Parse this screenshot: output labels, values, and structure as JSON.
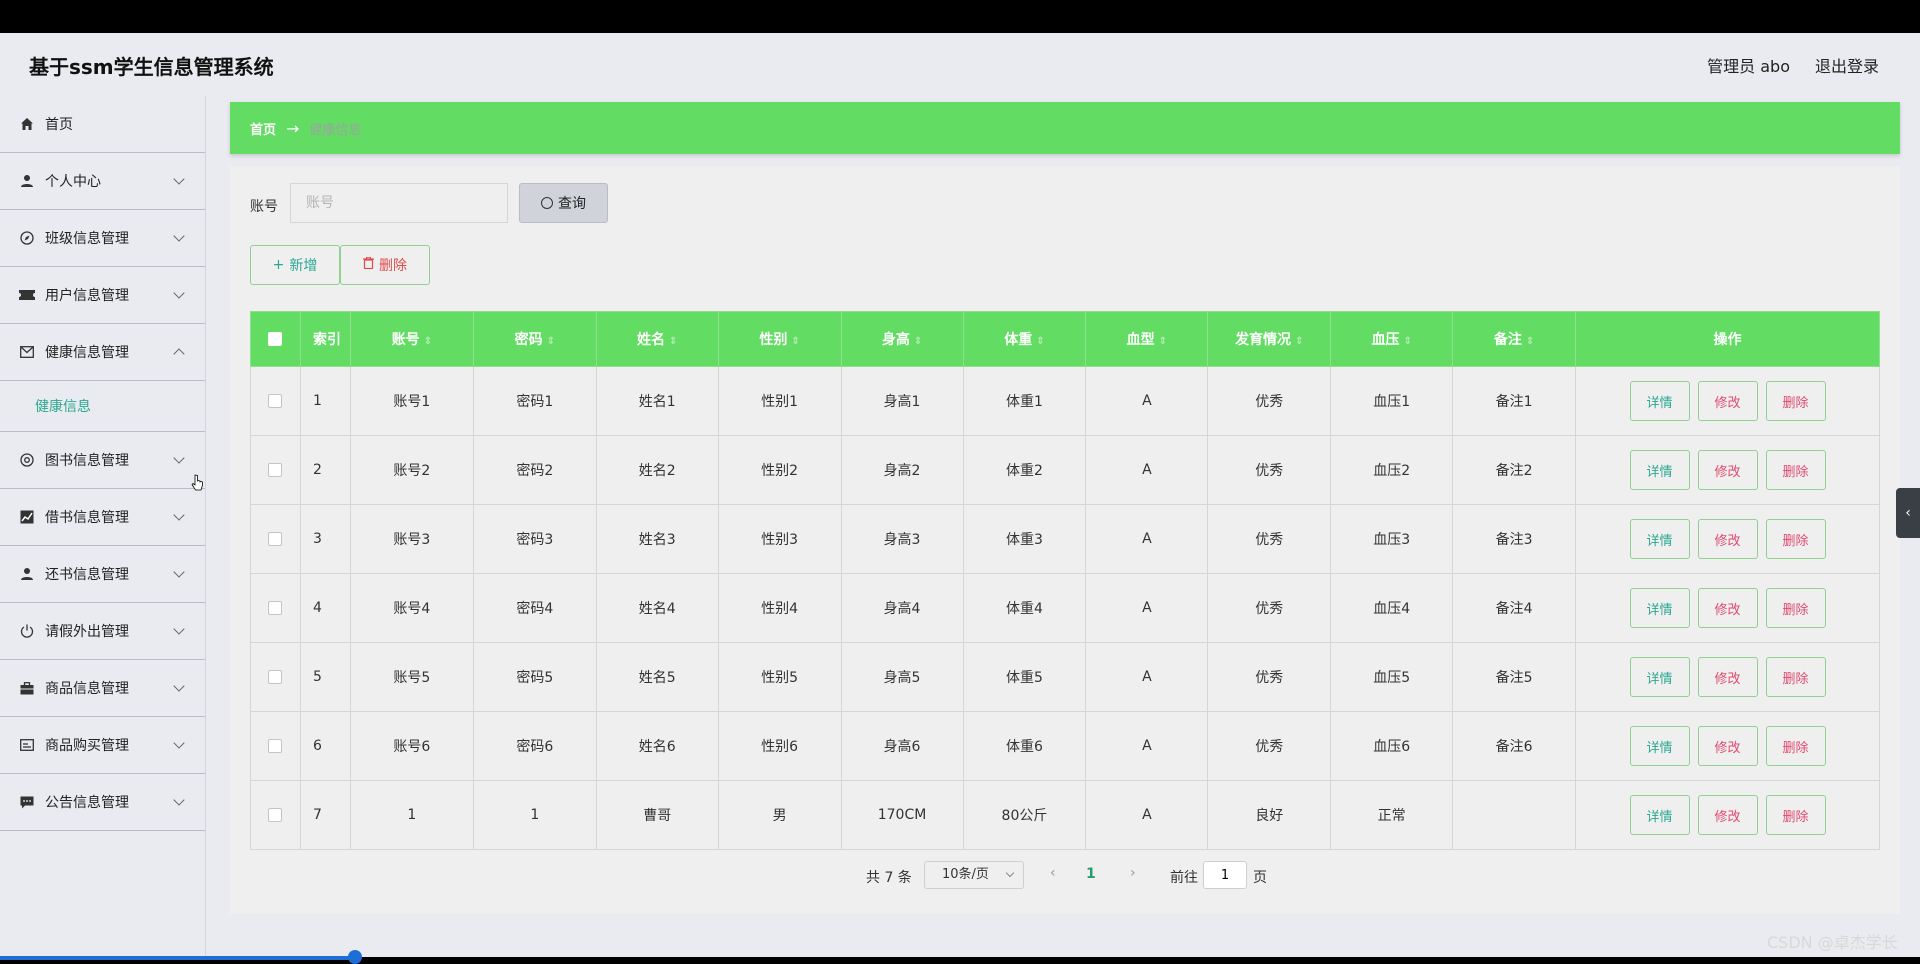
{
  "header": {
    "title": "基于ssm学生信息管理系统",
    "user": "管理员 abo",
    "logout": "退出登录"
  },
  "sidebar": {
    "items": [
      {
        "label": "首页",
        "icon": "home-icon"
      },
      {
        "label": "个人中心",
        "icon": "user-icon"
      },
      {
        "label": "班级信息管理",
        "icon": "compass-icon"
      },
      {
        "label": "用户信息管理",
        "icon": "ticket-icon"
      },
      {
        "label": "健康信息管理",
        "icon": "mail-icon"
      },
      {
        "label": "图书信息管理",
        "icon": "target-icon"
      },
      {
        "label": "借书信息管理",
        "icon": "chart-icon"
      },
      {
        "label": "还书信息管理",
        "icon": "user-icon"
      },
      {
        "label": "请假外出管理",
        "icon": "power-icon"
      },
      {
        "label": "商品信息管理",
        "icon": "briefcase-icon"
      },
      {
        "label": "商品购买管理",
        "icon": "card-icon"
      },
      {
        "label": "公告信息管理",
        "icon": "chat-icon"
      }
    ],
    "sub_item": "健康信息"
  },
  "breadcrumb": {
    "home": "首页",
    "arrow": "→",
    "current": "健康信息"
  },
  "search": {
    "label": "账号",
    "placeholder": "账号",
    "button": "查询"
  },
  "actions": {
    "add": "新增",
    "delete": "删除"
  },
  "table": {
    "columns": [
      "索引",
      "账号",
      "密码",
      "姓名",
      "性别",
      "身高",
      "体重",
      "血型",
      "发育情况",
      "血压",
      "备注",
      "操作"
    ],
    "rows": [
      [
        "1",
        "账号1",
        "密码1",
        "姓名1",
        "性别1",
        "身高1",
        "体重1",
        "A",
        "优秀",
        "血压1",
        "备注1"
      ],
      [
        "2",
        "账号2",
        "密码2",
        "姓名2",
        "性别2",
        "身高2",
        "体重2",
        "A",
        "优秀",
        "血压2",
        "备注2"
      ],
      [
        "3",
        "账号3",
        "密码3",
        "姓名3",
        "性别3",
        "身高3",
        "体重3",
        "A",
        "优秀",
        "血压3",
        "备注3"
      ],
      [
        "4",
        "账号4",
        "密码4",
        "姓名4",
        "性别4",
        "身高4",
        "体重4",
        "A",
        "优秀",
        "血压4",
        "备注4"
      ],
      [
        "5",
        "账号5",
        "密码5",
        "姓名5",
        "性别5",
        "身高5",
        "体重5",
        "A",
        "优秀",
        "血压5",
        "备注5"
      ],
      [
        "6",
        "账号6",
        "密码6",
        "姓名6",
        "性别6",
        "身高6",
        "体重6",
        "A",
        "优秀",
        "血压6",
        "备注6"
      ],
      [
        "7",
        "1",
        "1",
        "曹哥",
        "男",
        "170CM",
        "80公斤",
        "A",
        "良好",
        "正常",
        ""
      ]
    ],
    "row_actions": {
      "detail": "详情",
      "edit": "修改",
      "remove": "删除"
    }
  },
  "pager": {
    "total": "共 7 条",
    "page_size": "10条/页",
    "prev": "‹",
    "current": "1",
    "next": "›",
    "goto_label": "前往",
    "goto_value": "1",
    "page_suffix": "页"
  },
  "watermark": "CSDN @卓杰学长",
  "colors": {
    "accent_green": "#63dc63",
    "teal_text": "#2aa890",
    "danger": "#e04a6f"
  }
}
